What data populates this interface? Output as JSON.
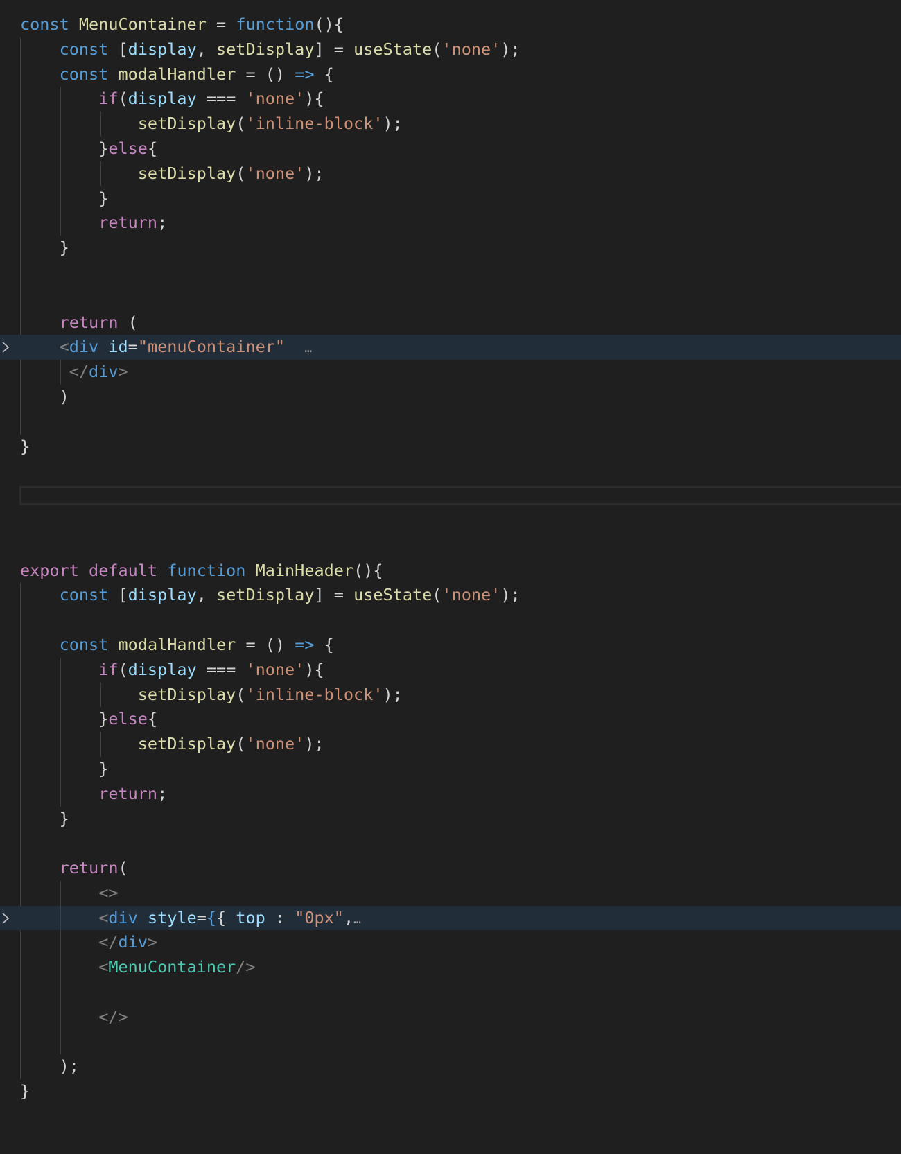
{
  "editor": {
    "theme_background": "#1f1f1f",
    "highlight_background": "#222d3a",
    "collapsed_marker": "…",
    "lines": [
      "const MenuContainer = function(){",
      "    const [display, setDisplay] = useState('none');",
      "    const modalHandler = () => {",
      "        if(display === 'none'){",
      "            setDisplay('inline-block');",
      "        }else{",
      "            setDisplay('none');",
      "        }",
      "        return;",
      "    }",
      "",
      "",
      "    return (",
      "    <div id=\"menuContainer\"",
      "     </div>",
      "    )",
      "",
      "}",
      "",
      "",
      "",
      "export default function MainHeader(){",
      "    const [display, setDisplay] = useState('none');",
      "",
      "    const modalHandler = () => {",
      "        if(display === 'none'){",
      "            setDisplay('inline-block');",
      "        }else{",
      "            setDisplay('none');",
      "        }",
      "        return;",
      "    }",
      "",
      "    return(",
      "        <>",
      "        <div style={{ top : \"0px\",",
      "        </div>",
      "        <MenuContainer/>",
      "",
      "        </>",
      "",
      "    );",
      "}"
    ]
  },
  "tokens": {
    "const": "const",
    "function": "function",
    "export": "export",
    "default": "default",
    "if": "if",
    "else": "else",
    "return": "return",
    "MenuContainer": "MenuContainer",
    "MainHeader": "MainHeader",
    "display": "display",
    "setDisplay": "setDisplay",
    "useState": "useState",
    "modalHandler": "modalHandler",
    "str_none": "'none'",
    "str_inline_block": "'inline-block'",
    "div": "div",
    "id_attr": "id",
    "menuContainer_str": "\"menuContainer\"",
    "style_attr": "style",
    "top_key": "top",
    "zero_px": "\"0px\""
  }
}
